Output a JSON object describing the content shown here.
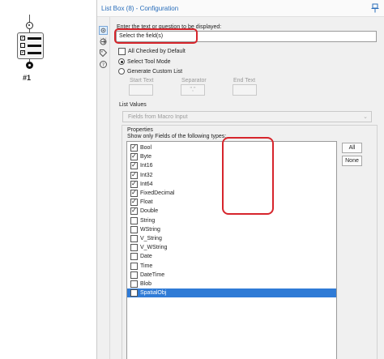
{
  "canvas": {
    "node_label": "#1"
  },
  "window": {
    "title": "List Box (8) - Configuration"
  },
  "prompt": {
    "label": "Enter the text or question to be displayed:",
    "value": "Select the field(s)"
  },
  "options": {
    "all_checked_label": "All Checked by Default",
    "all_checked": false,
    "select_tool_mode_label": "Select Tool Mode",
    "generate_custom_list_label": "Generate Custom List",
    "start_text_label": "Start Text",
    "separator_label": "Separator",
    "separator_value": "\",\"",
    "end_text_label": "End Text"
  },
  "list_values": {
    "label": "List Values",
    "selected": "Fields from Macro Input"
  },
  "properties": {
    "title": "Properties",
    "show_only_label": "Show only Fields of the following types:",
    "types": [
      {
        "name": "Bool",
        "checked": true
      },
      {
        "name": "Byte",
        "checked": true
      },
      {
        "name": "Int16",
        "checked": true
      },
      {
        "name": "Int32",
        "checked": true
      },
      {
        "name": "Int64",
        "checked": true
      },
      {
        "name": "FixedDecimal",
        "checked": true
      },
      {
        "name": "Float",
        "checked": true
      },
      {
        "name": "Double",
        "checked": true
      },
      {
        "name": "String",
        "checked": false
      },
      {
        "name": "WString",
        "checked": false
      },
      {
        "name": "V_String",
        "checked": false
      },
      {
        "name": "V_WString",
        "checked": false
      },
      {
        "name": "Date",
        "checked": false
      },
      {
        "name": "Time",
        "checked": false
      },
      {
        "name": "DateTime",
        "checked": false
      },
      {
        "name": "Blob",
        "checked": false
      },
      {
        "name": "SpatialObj",
        "checked": false,
        "selected": true
      }
    ],
    "all_button": "All",
    "none_button": "None"
  },
  "colors": {
    "highlight": "#d6252c",
    "selection": "#2f7bd6",
    "title_text": "#2a6ebb"
  },
  "icons": [
    "gear-icon",
    "connection-icon",
    "tag-icon",
    "help-icon",
    "pin-icon"
  ]
}
